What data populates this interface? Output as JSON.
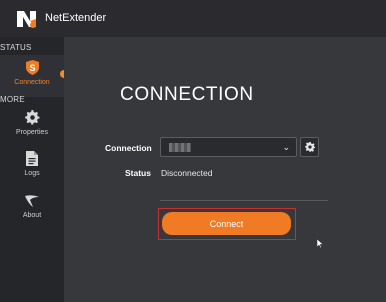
{
  "app": {
    "title": "NetExtender"
  },
  "sidebar": {
    "status_label": "STATUS",
    "more_label": "MORE",
    "items": [
      {
        "label": "Connection",
        "icon": "shield-s-icon",
        "active": true
      },
      {
        "label": "Properties",
        "icon": "gear-icon",
        "active": false
      },
      {
        "label": "Logs",
        "icon": "document-icon",
        "active": false
      },
      {
        "label": "About",
        "icon": "sonicwall-swoosh-icon",
        "active": false
      }
    ]
  },
  "main": {
    "heading": "CONNECTION",
    "connection_label": "Connection",
    "connection_value": "",
    "status_label": "Status",
    "status_value": "Disconnected",
    "connect_button": "Connect"
  },
  "colors": {
    "accent": "#f07b24",
    "highlight_border": "#c7302f",
    "sidebar_bg": "#25262a",
    "main_bg": "#37383c"
  }
}
